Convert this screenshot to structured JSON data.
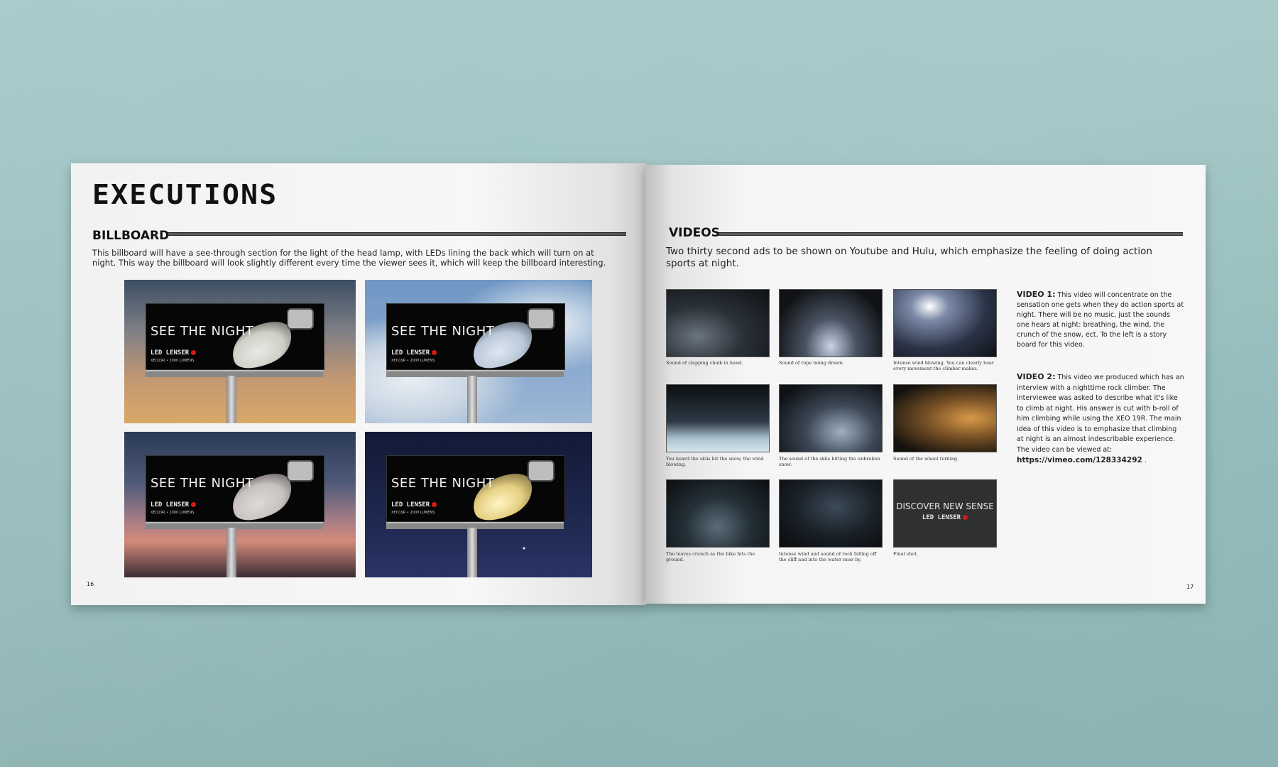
{
  "left_page": {
    "title": "EXECUTIONS",
    "section": "BILLBOARD",
    "description": "This billboard will have a see-through section for the light of the head lamp, with LEDs lining the back which will turn on at night. This way the billboard will look slightly different every time the viewer sees it, which will keep the billboard interesting.",
    "billboard_headline": "SEE THE NIGHT",
    "brand": "LED LENSER",
    "model": "XEO19R • 2000 LUMENS",
    "page_number": "16"
  },
  "right_page": {
    "section": "VIDEOS",
    "description": "Two thirty second ads to be shown on Youtube and Hulu, which emphasize the feeling of doing action sports at night.",
    "storyboard": [
      {
        "caption": "Sound of clapping chalk in hand."
      },
      {
        "caption": "Sound of rope being drawn."
      },
      {
        "caption": "Intense wind blowing. You can clearly hear every movement the climber makes."
      },
      {
        "caption": "You heard the skiis hit the snow, the wind blowing."
      },
      {
        "caption": "The sound of the skiis hitting the unbroken snow."
      },
      {
        "caption": "Sound of the wheel turning."
      },
      {
        "caption": "The leaves crunch as the bike hits the ground."
      },
      {
        "caption": "Intense wind and sound of rock falling off the cliff and into the water near by."
      },
      {
        "caption": "Final shot."
      }
    ],
    "final_shot_text": "DISCOVER NEW SENSE",
    "final_shot_brand": "LED LENSER",
    "video1_label": "VIDEO 1:",
    "video1_text": "This video will concentrate on the sensation one gets when they do action sports at night. There will be no music, just the sounds one hears at night: breathing, the wind, the crunch of the snow, ect. To the left is a story board for this video.",
    "video2_label": "VIDEO 2:",
    "video2_text": "This video we produced which has an interview with a nighttime rock climber. The interviewee was asked to describe what it's like to climb at night. His answer is cut with b-roll of him climbing while using the XEO 19R. The main idea of this video is to emphasize that climbing at night is an almost indescribable experience. The video can be viewed at:",
    "video2_link": "https://vimeo.com/128334292",
    "video2_link_suffix": " .",
    "page_number": "17"
  }
}
